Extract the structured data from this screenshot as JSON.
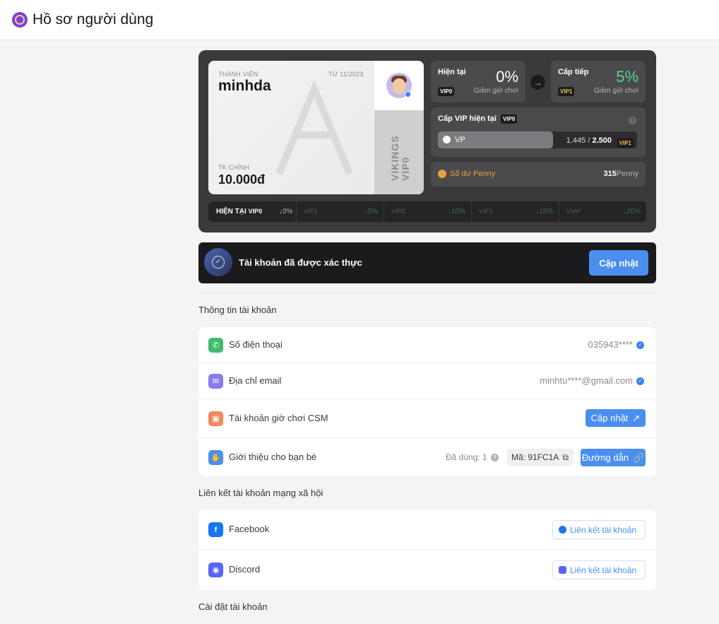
{
  "header": {
    "title": "Hồ sơ người dùng"
  },
  "member_card": {
    "member_label": "THÀNH VIÊN",
    "since": "TỪ 11/2023",
    "username": "minhda",
    "main_account_label": "TK CHÍNH",
    "balance": "10.000đ",
    "side_text_brand": "VIKINGS",
    "side_text_tier": "VIP0"
  },
  "current_tier": {
    "title": "Hiện tại",
    "tag": "VIP0",
    "percent": "0%",
    "subtitle": "Giảm giờ chơi"
  },
  "next_tier": {
    "title": "Cấp tiếp",
    "tag": "VIP1",
    "percent": "5%",
    "subtitle": "Giảm giờ chơi"
  },
  "vip_level": {
    "title": "Cấp VIP hiện tại",
    "tag": "VIP0",
    "bar_label": "VP",
    "bar_current": "1.445",
    "bar_separator": "/",
    "bar_max": "2.500",
    "bar_next_tag": "VIP1",
    "progress_fraction": 0.578
  },
  "penny": {
    "label": "Số dư Penny",
    "amount": "315",
    "unit": "Penny"
  },
  "tier_strip": {
    "current_label": "HIỆN TẠI",
    "current_tag": "VIP0",
    "current_percent": "↓0%",
    "tiers": [
      {
        "name": "VIP1",
        "percent": "↓5%"
      },
      {
        "name": "VIP2",
        "percent": "↓10%"
      },
      {
        "name": "VIP3",
        "percent": "↓15%"
      },
      {
        "name": "VVIP",
        "percent": "↓20%"
      }
    ]
  },
  "verify_banner": {
    "text": "Tài khoản đã được xác thực",
    "button": "Cập nhật"
  },
  "account_info": {
    "section_title": "Thông tin tài khoản",
    "phone_label": "Số điện thoại",
    "phone_value": "035943****",
    "email_label": "Địa chỉ email",
    "email_value": "minhtu****@gmail.com",
    "csm_label": "Tài khoản giờ chơi CSM",
    "csm_button": "Cập nhật",
    "referral_label": "Giới thiệu cho bạn bè",
    "referral_used": "Đã dùng: 1",
    "referral_code": "Mã: 91FC1A",
    "referral_link_button": "Đường dẫn"
  },
  "social": {
    "section_title": "Liên kết tài khoản mạng xã hội",
    "facebook_label": "Facebook",
    "facebook_button": "Liên kết tài khoản",
    "discord_label": "Discord",
    "discord_button": "Liên kết tài khoản"
  },
  "settings": {
    "section_title": "Cài đặt tài khoản"
  },
  "colors": {
    "accent_blue": "#4a8ff0",
    "vip_gold": "#f2c14e",
    "next_tier_green": "#5ad28a",
    "phone_icon": "#3dbb6c",
    "email_icon": "#8a7cf0",
    "csm_icon": "#f08a5d",
    "referral_icon": "#4a8ff0",
    "facebook": "#1877f2",
    "discord": "#5865f2"
  }
}
